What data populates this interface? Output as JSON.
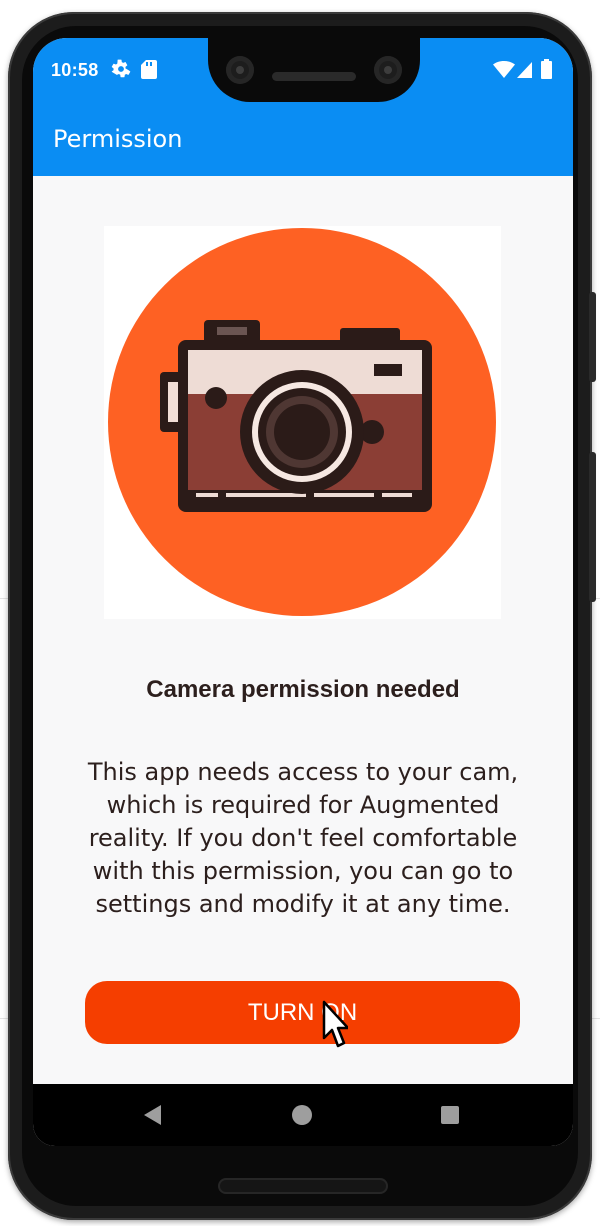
{
  "status_bar": {
    "time": "10:58",
    "left_icons": [
      "gear-icon",
      "sd-card-icon"
    ],
    "right_icons": [
      "wifi-icon",
      "cell-signal-icon",
      "battery-icon"
    ],
    "color": "#0a8df3"
  },
  "app_bar": {
    "title": "Permission",
    "color": "#0a8df3"
  },
  "content": {
    "illustration_icon": "camera-icon",
    "illustration_bg": "#fe6123",
    "heading": "Camera permission needed",
    "description": "This app needs access to your cam, which is required for Augmented reality. If you don't feel comfortable with this permission, you can go to settings and modify it at any time.",
    "button_label": "TURN ON",
    "button_color": "#f53e00"
  },
  "nav_bar": {
    "buttons": [
      "back-icon",
      "home-icon",
      "recents-icon"
    ]
  }
}
